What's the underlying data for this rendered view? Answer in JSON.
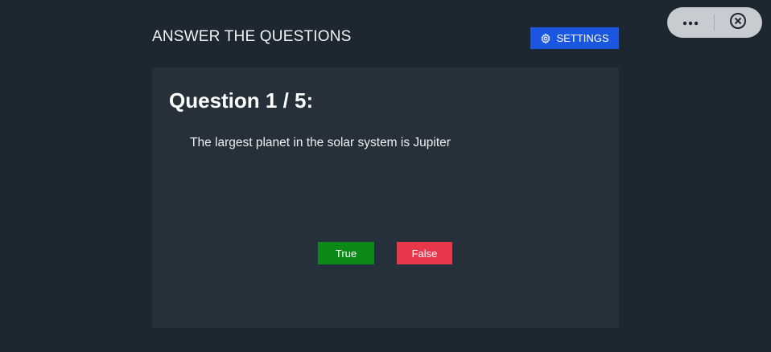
{
  "header": {
    "title": "ANSWER THE QUESTIONS",
    "settings_label": "SETTINGS",
    "settings_icon": "gear-icon",
    "accent_color": "#1b56e0"
  },
  "capsule": {
    "more_icon": "more-dots-icon",
    "close_icon": "close-circle-icon"
  },
  "question": {
    "heading": "Question 1 / 5:",
    "text": "The largest planet in the solar system is Jupiter"
  },
  "answers": {
    "true_label": "True",
    "false_label": "False",
    "true_color": "#0b8a17",
    "false_color": "#e8374a"
  }
}
